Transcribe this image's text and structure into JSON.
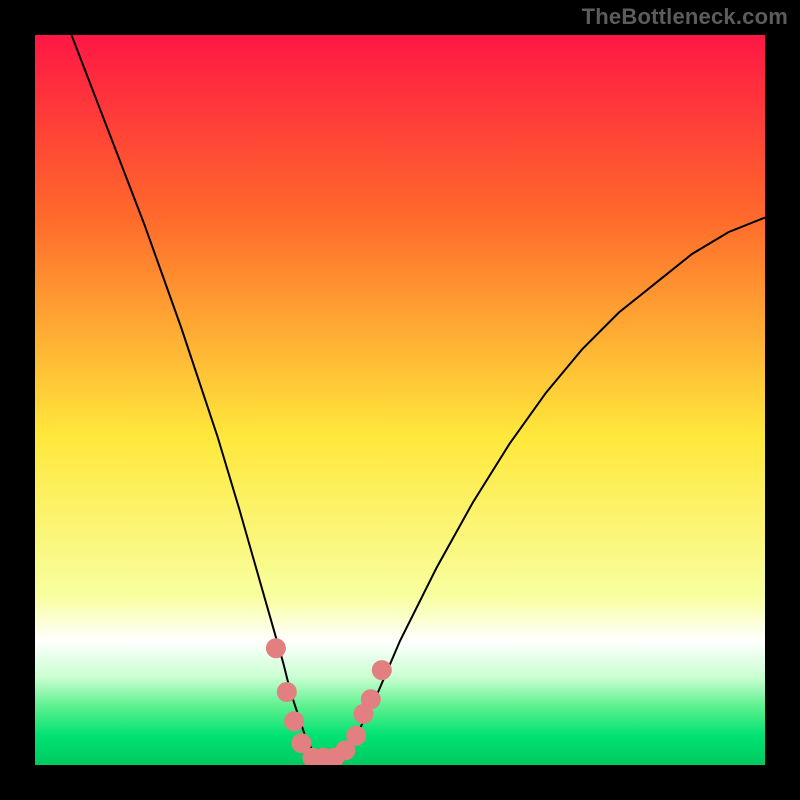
{
  "watermark": "TheBottleneck.com",
  "chart_data": {
    "type": "line",
    "title": "",
    "xlabel": "",
    "ylabel": "",
    "xlim": [
      0,
      100
    ],
    "ylim": [
      0,
      100
    ],
    "grid": false,
    "legend": false,
    "gradient_stops": [
      {
        "offset": 0,
        "color": "#ff1744"
      },
      {
        "offset": 25,
        "color": "#ff6a2b"
      },
      {
        "offset": 55,
        "color": "#ffe83b"
      },
      {
        "offset": 77,
        "color": "#f8ffa0"
      },
      {
        "offset": 83,
        "color": "#ffffff"
      },
      {
        "offset": 88,
        "color": "#c9ffd1"
      },
      {
        "offset": 92,
        "color": "#5cf08e"
      },
      {
        "offset": 96,
        "color": "#00e272"
      },
      {
        "offset": 100,
        "color": "#00c95f"
      }
    ],
    "series": [
      {
        "name": "bottleneck-curve",
        "color": "#000000",
        "x": [
          5,
          10,
          15,
          20,
          25,
          28,
          30,
          32,
          34,
          35,
          36,
          37,
          38,
          39,
          40,
          41,
          42,
          43,
          44,
          45,
          47,
          50,
          55,
          60,
          65,
          70,
          75,
          80,
          85,
          90,
          95,
          100
        ],
        "y": [
          100,
          87,
          74,
          60,
          45,
          35,
          28,
          21,
          14,
          10,
          7,
          4,
          2,
          1,
          1,
          1,
          1,
          2,
          4,
          6,
          10,
          17,
          27,
          36,
          44,
          51,
          57,
          62,
          66,
          70,
          73,
          75
        ]
      }
    ],
    "marker_points": {
      "name": "optimal-zone-markers",
      "color": "#e27f80",
      "radius": 10,
      "points": [
        {
          "x": 33.0,
          "y": 16
        },
        {
          "x": 34.5,
          "y": 10
        },
        {
          "x": 35.5,
          "y": 6
        },
        {
          "x": 36.5,
          "y": 3
        },
        {
          "x": 38.0,
          "y": 1
        },
        {
          "x": 39.5,
          "y": 1
        },
        {
          "x": 41.0,
          "y": 1
        },
        {
          "x": 42.5,
          "y": 2
        },
        {
          "x": 44.0,
          "y": 4
        },
        {
          "x": 45.0,
          "y": 7
        },
        {
          "x": 46.0,
          "y": 9
        },
        {
          "x": 47.5,
          "y": 13
        }
      ]
    }
  }
}
